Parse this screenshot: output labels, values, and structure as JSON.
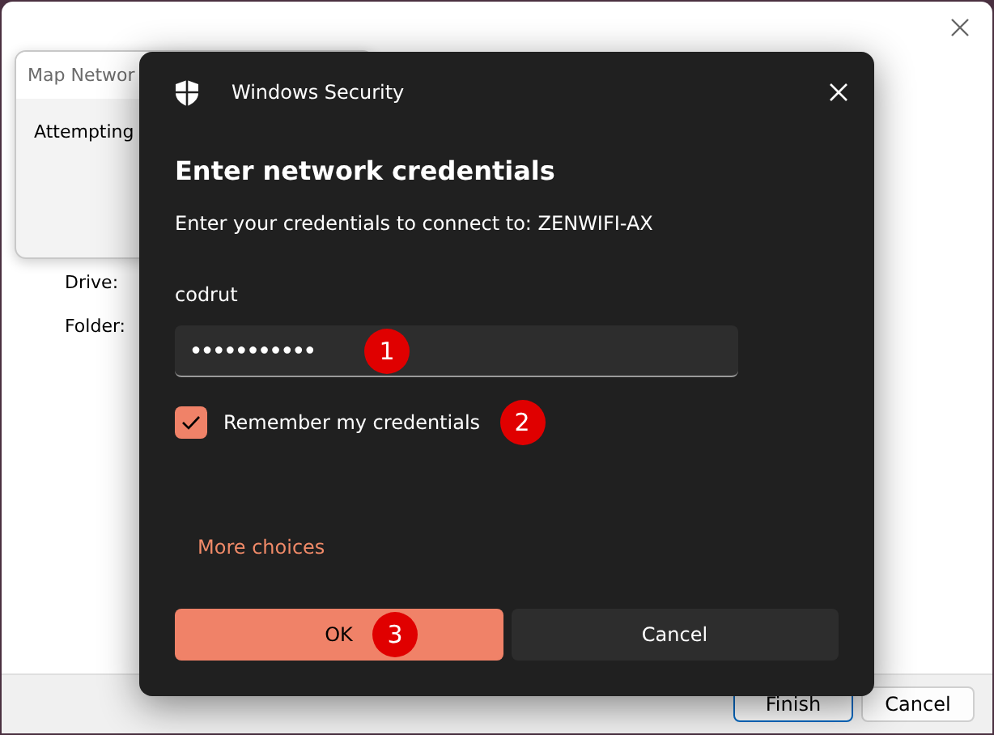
{
  "background_window": {
    "wizard_labels": [
      "Drive:",
      "Folder:"
    ],
    "buttons": [
      {
        "label": "Finish",
        "kind": "default"
      },
      {
        "label": "Cancel",
        "kind": "normal"
      }
    ]
  },
  "progress_dialog": {
    "title": "Map Networ",
    "message": "Attempting"
  },
  "security_dialog": {
    "title": "Windows Security",
    "heading": "Enter network credentials",
    "subtitle": "Enter your credentials to connect to: ZENWIFI-AX",
    "username": "codrut",
    "password": "●●●●●●●●●●●",
    "password_badge": "1",
    "remember": {
      "label": "Remember my credentials",
      "checked": true,
      "badge": "2"
    },
    "more_choices": "More choices",
    "buttons": [
      {
        "label": "OK",
        "kind": "primary",
        "badge": "3"
      },
      {
        "label": "Cancel",
        "kind": "secondary"
      }
    ]
  }
}
